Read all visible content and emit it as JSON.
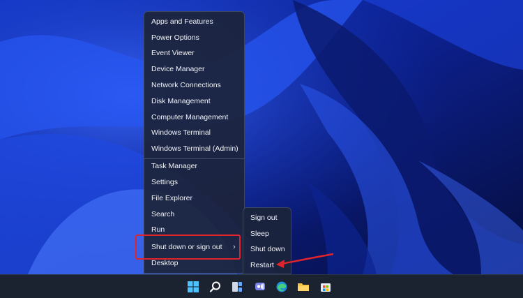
{
  "winx_menu": {
    "items_group1": [
      "Apps and Features",
      "Power Options",
      "Event Viewer",
      "Device Manager",
      "Network Connections",
      "Disk Management",
      "Computer Management",
      "Windows Terminal",
      "Windows Terminal (Admin)"
    ],
    "items_group2": [
      "Task Manager",
      "Settings",
      "File Explorer",
      "Search",
      "Run",
      "Shut down or sign out",
      "Desktop"
    ],
    "chevron": "›"
  },
  "submenu": {
    "items": [
      "Sign out",
      "Sleep",
      "Shut down",
      "Restart"
    ]
  },
  "colors": {
    "highlight_border": "#e0242c",
    "arrow": "#e0242c",
    "menu_bg": "#1c243a",
    "taskbar_bg": "#1b2330"
  },
  "taskbar": {
    "icons": [
      "start-icon",
      "search-icon",
      "task-view-icon",
      "chat-icon",
      "edge-icon",
      "file-explorer-icon",
      "store-icon"
    ]
  }
}
